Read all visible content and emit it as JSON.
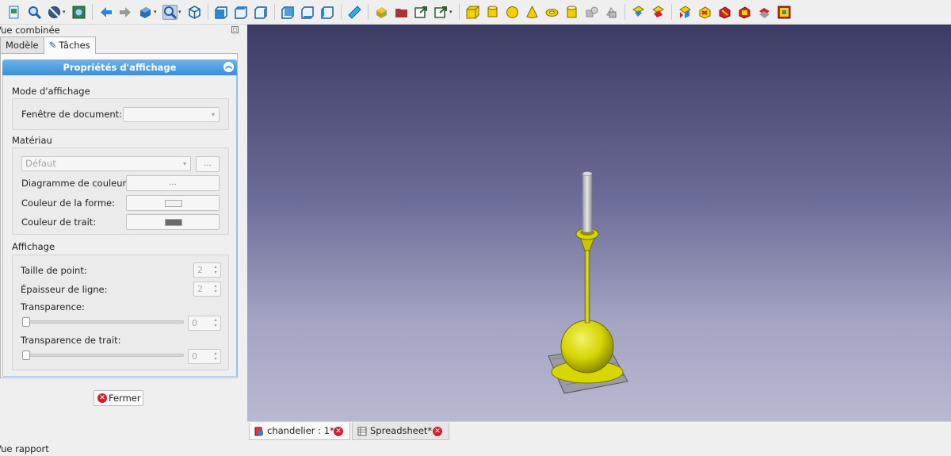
{
  "toolbar": {
    "icons": [
      "new-icon",
      "zoom-icon",
      "draw-style-icon",
      "std-views-icon",
      "back-icon",
      "forward-icon",
      "workbench-icon",
      "zoom-fit-icon",
      "isometric-icon",
      "front-icon",
      "top-icon",
      "right-icon",
      "rear-icon",
      "bottom-icon",
      "left-icon",
      "measure-icon",
      "part-icon",
      "group-icon",
      "link-icon",
      "link-make-icon",
      "box-icon",
      "cylinder-icon",
      "sphere-icon",
      "cone-icon",
      "torus-icon",
      "tube-icon",
      "primitives-icon",
      "shape-builder-icon",
      "extrude-icon",
      "revolve-icon",
      "mirror-icon",
      "fillet-icon",
      "chamfer-icon",
      "make-face-icon",
      "ruled-surface-icon",
      "loft-icon"
    ]
  },
  "left_panel": {
    "title": "Vue combinée",
    "tabs": [
      "Modèle",
      "Tâches"
    ],
    "task_header": "Propriétés d'affichage",
    "display_mode": {
      "group_title": "Mode d'affichage",
      "document_window_label": "Fenêtre de document:",
      "document_window_value": ""
    },
    "material": {
      "group_title": "Matériau",
      "material_value": "Défaut",
      "material_button": "...",
      "color_plot_label": "Diagramme de couleur:",
      "color_plot_button": "...",
      "shape_color_label": "Couleur de la forme:",
      "shape_color": "#f2f2f2",
      "line_color_label": "Couleur de trait:",
      "line_color": "#6a6a6a"
    },
    "appearance": {
      "group_title": "Affichage",
      "point_size_label": "Taille de point:",
      "point_size_value": "2",
      "line_width_label": "Épaisseur de ligne:",
      "line_width_value": "2",
      "transparency_label": "Transparence:",
      "transparency_value": "0",
      "line_transparency_label": "Transparence de trait:",
      "line_transparency_value": "0"
    },
    "close_button": "Fermer"
  },
  "document_tabs": [
    {
      "label": "chandelier : 1*",
      "icon": "freecad-doc-icon",
      "active": true
    },
    {
      "label": "Spreadsheet*",
      "icon": "spreadsheet-icon",
      "active": false
    }
  ],
  "report_view_title": "Vue rapport",
  "model": {
    "body_color": "#d4d400",
    "stem_color": "#c8c8c8"
  }
}
